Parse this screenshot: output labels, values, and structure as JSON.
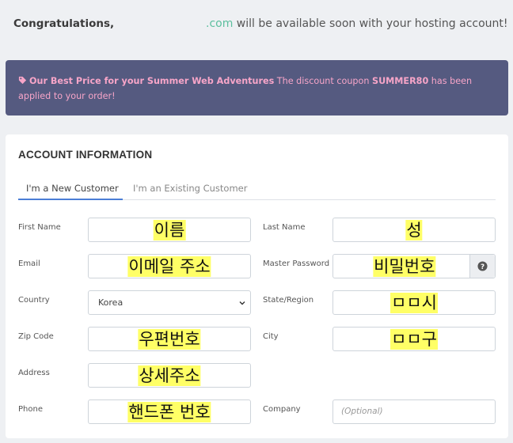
{
  "header": {
    "congrats_label": "Congratulations,",
    "domain_suffix": ".com",
    "message": " will be available soon with your hosting account!"
  },
  "promo": {
    "icon": "tag-icon",
    "title": "Our Best Price for your Summer Web Adventures",
    "text_before": " The discount coupon ",
    "coupon": "SUMMER80",
    "text_after": " has been applied to your order!"
  },
  "account": {
    "title": "ACCOUNT INFORMATION",
    "tabs": [
      {
        "label": "I'm a New Customer",
        "active": true
      },
      {
        "label": "I'm an Existing Customer",
        "active": false
      }
    ]
  },
  "form": {
    "first_name": {
      "label": "First Name",
      "value": "이름"
    },
    "last_name": {
      "label": "Last Name",
      "value": "성"
    },
    "email": {
      "label": "Email",
      "value": "이메일 주소"
    },
    "master_password": {
      "label": "Master Password",
      "value": "비밀번호",
      "help_icon": "question-circle-icon"
    },
    "country": {
      "label": "Country",
      "value": "Korea"
    },
    "state": {
      "label": "State/Region",
      "value": "ㅁㅁ시"
    },
    "zip": {
      "label": "Zip Code",
      "value": "우편번호"
    },
    "city": {
      "label": "City",
      "value": "ㅁㅁ구"
    },
    "address": {
      "label": "Address",
      "value": "상세주소"
    },
    "phone": {
      "label": "Phone",
      "value": "핸드폰 번호"
    },
    "company": {
      "label": "Company",
      "placeholder": "(Optional)"
    }
  },
  "colors": {
    "promo_bg": "#555a80",
    "promo_text": "#f7a5c8",
    "domain": "#5cbf9e",
    "tab_active": "#4b7ed6",
    "highlight": "#ffff66"
  }
}
